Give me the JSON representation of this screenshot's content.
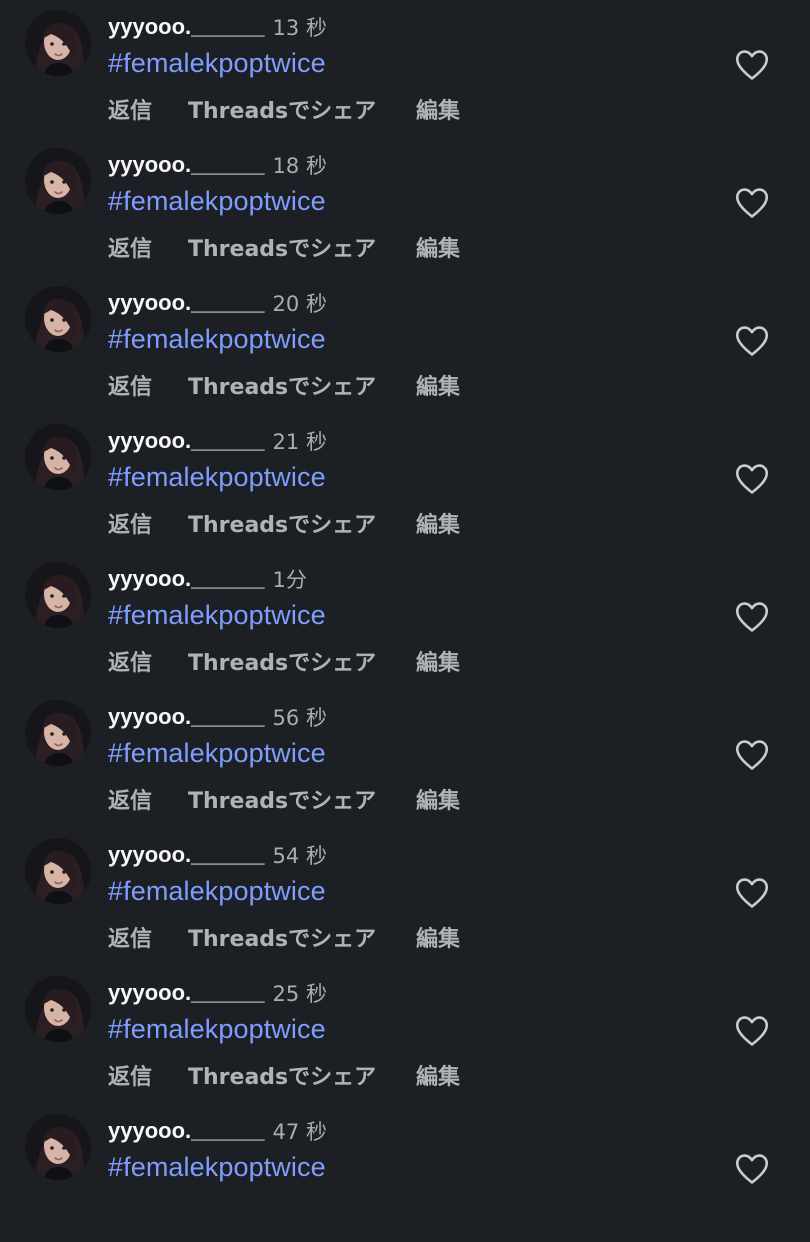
{
  "comments": [
    {
      "username": "yyyooo.______",
      "time": "13 秒",
      "text": "#femalekpoptwice",
      "actions": {
        "reply": "返信",
        "share": "Threadsでシェア",
        "edit": "編集"
      }
    },
    {
      "username": "yyyooo.______",
      "time": "18 秒",
      "text": "#femalekpoptwice",
      "actions": {
        "reply": "返信",
        "share": "Threadsでシェア",
        "edit": "編集"
      }
    },
    {
      "username": "yyyooo.______",
      "time": "20 秒",
      "text": "#femalekpoptwice",
      "actions": {
        "reply": "返信",
        "share": "Threadsでシェア",
        "edit": "編集"
      }
    },
    {
      "username": "yyyooo.______",
      "time": "21 秒",
      "text": "#femalekpoptwice",
      "actions": {
        "reply": "返信",
        "share": "Threadsでシェア",
        "edit": "編集"
      }
    },
    {
      "username": "yyyooo.______",
      "time": "1分",
      "text": "#femalekpoptwice",
      "actions": {
        "reply": "返信",
        "share": "Threadsでシェア",
        "edit": "編集"
      }
    },
    {
      "username": "yyyooo.______",
      "time": "56 秒",
      "text": "#femalekpoptwice",
      "actions": {
        "reply": "返信",
        "share": "Threadsでシェア",
        "edit": "編集"
      }
    },
    {
      "username": "yyyooo.______",
      "time": "54 秒",
      "text": "#femalekpoptwice",
      "actions": {
        "reply": "返信",
        "share": "Threadsでシェア",
        "edit": "編集"
      }
    },
    {
      "username": "yyyooo.______",
      "time": "25 秒",
      "text": "#femalekpoptwice",
      "actions": {
        "reply": "返信",
        "share": "Threadsでシェア",
        "edit": "編集"
      }
    },
    {
      "username": "yyyooo.______",
      "time": "47 秒",
      "text": "#femalekpoptwice",
      "actions": {
        "reply": "",
        "share": "",
        "edit": ""
      }
    }
  ],
  "icons": {
    "avatar": "profile-avatar-icon",
    "like": "heart-outline-icon"
  },
  "colors": {
    "background": "#1c1f23",
    "username": "#f7f7f7",
    "secondary_text": "#a8adb4",
    "hashtag": "#7f9dff",
    "heart": "#c8ccd1"
  }
}
